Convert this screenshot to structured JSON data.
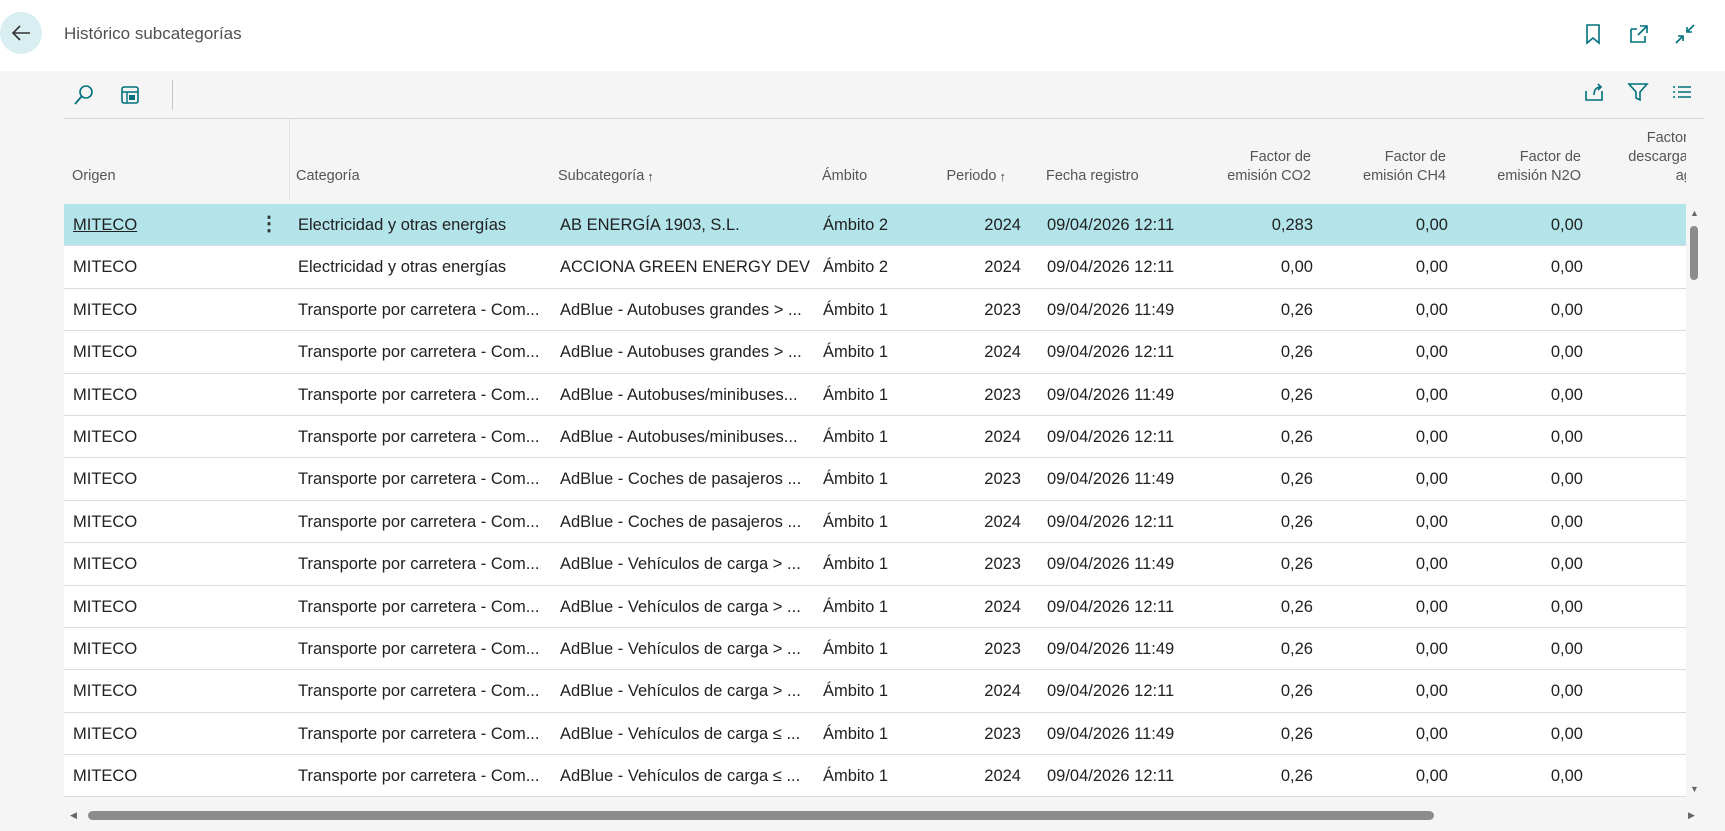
{
  "page": {
    "title": "Histórico subcategorías"
  },
  "icons": {
    "back": "arrow-left-icon",
    "bookmark": "bookmark-icon",
    "open_new": "open-in-new-window-icon",
    "collapse": "collapse-icon",
    "search": "search-icon",
    "layout": "layout-icon",
    "share": "share-icon",
    "filter": "filter-icon",
    "list": "list-view-icon"
  },
  "colors": {
    "accent": "#00717c",
    "selected_row": "#b2e4ea",
    "back_bg": "#d8eef0"
  },
  "columns": {
    "origen": "Origen",
    "categoria": "Categoría",
    "subcategoria": "Subcategoría",
    "ambito": "Ámbito",
    "periodo": "Periodo",
    "fecha": "Fecha registro",
    "co2": "Factor de emisión CO2",
    "ch4": "Factor de emisión CH4",
    "n2o": "Factor de emisión N2O",
    "descarga": "Factor de descarga en agua",
    "sort_arrow": "↑"
  },
  "rows": [
    {
      "origen": "MITECO",
      "categoria": "Electricidad y otras energías",
      "subcategoria": "AB ENERGÍA 1903, S.L.",
      "ambito": "Ámbito 2",
      "periodo": "2024",
      "fecha": "09/04/2026 12:11",
      "co2": "0,283",
      "ch4": "0,00",
      "n2o": "0,00"
    },
    {
      "origen": "MITECO",
      "categoria": "Electricidad y otras energías",
      "subcategoria": "ACCIONA GREEN ENERGY DEV...",
      "ambito": "Ámbito 2",
      "periodo": "2024",
      "fecha": "09/04/2026 12:11",
      "co2": "0,00",
      "ch4": "0,00",
      "n2o": "0,00"
    },
    {
      "origen": "MITECO",
      "categoria": "Transporte por carretera - Com...",
      "subcategoria": "AdBlue - Autobuses grandes > ...",
      "ambito": "Ámbito 1",
      "periodo": "2023",
      "fecha": "09/04/2026 11:49",
      "co2": "0,26",
      "ch4": "0,00",
      "n2o": "0,00"
    },
    {
      "origen": "MITECO",
      "categoria": "Transporte por carretera - Com...",
      "subcategoria": "AdBlue - Autobuses grandes > ...",
      "ambito": "Ámbito 1",
      "periodo": "2024",
      "fecha": "09/04/2026 12:11",
      "co2": "0,26",
      "ch4": "0,00",
      "n2o": "0,00"
    },
    {
      "origen": "MITECO",
      "categoria": "Transporte por carretera - Com...",
      "subcategoria": "AdBlue - Autobuses/minibuses...",
      "ambito": "Ámbito 1",
      "periodo": "2023",
      "fecha": "09/04/2026 11:49",
      "co2": "0,26",
      "ch4": "0,00",
      "n2o": "0,00"
    },
    {
      "origen": "MITECO",
      "categoria": "Transporte por carretera - Com...",
      "subcategoria": "AdBlue - Autobuses/minibuses...",
      "ambito": "Ámbito 1",
      "periodo": "2024",
      "fecha": "09/04/2026 12:11",
      "co2": "0,26",
      "ch4": "0,00",
      "n2o": "0,00"
    },
    {
      "origen": "MITECO",
      "categoria": "Transporte por carretera - Com...",
      "subcategoria": "AdBlue - Coches de pasajeros ...",
      "ambito": "Ámbito 1",
      "periodo": "2023",
      "fecha": "09/04/2026 11:49",
      "co2": "0,26",
      "ch4": "0,00",
      "n2o": "0,00"
    },
    {
      "origen": "MITECO",
      "categoria": "Transporte por carretera - Com...",
      "subcategoria": "AdBlue - Coches de pasajeros ...",
      "ambito": "Ámbito 1",
      "periodo": "2024",
      "fecha": "09/04/2026 12:11",
      "co2": "0,26",
      "ch4": "0,00",
      "n2o": "0,00"
    },
    {
      "origen": "MITECO",
      "categoria": "Transporte por carretera - Com...",
      "subcategoria": "AdBlue - Vehículos de carga > ...",
      "ambito": "Ámbito 1",
      "periodo": "2023",
      "fecha": "09/04/2026 11:49",
      "co2": "0,26",
      "ch4": "0,00",
      "n2o": "0,00"
    },
    {
      "origen": "MITECO",
      "categoria": "Transporte por carretera - Com...",
      "subcategoria": "AdBlue - Vehículos de carga > ...",
      "ambito": "Ámbito 1",
      "periodo": "2024",
      "fecha": "09/04/2026 12:11",
      "co2": "0,26",
      "ch4": "0,00",
      "n2o": "0,00"
    },
    {
      "origen": "MITECO",
      "categoria": "Transporte por carretera - Com...",
      "subcategoria": "AdBlue - Vehículos de carga > ...",
      "ambito": "Ámbito 1",
      "periodo": "2023",
      "fecha": "09/04/2026 11:49",
      "co2": "0,26",
      "ch4": "0,00",
      "n2o": "0,00"
    },
    {
      "origen": "MITECO",
      "categoria": "Transporte por carretera - Com...",
      "subcategoria": "AdBlue - Vehículos de carga > ...",
      "ambito": "Ámbito 1",
      "periodo": "2024",
      "fecha": "09/04/2026 12:11",
      "co2": "0,26",
      "ch4": "0,00",
      "n2o": "0,00"
    },
    {
      "origen": "MITECO",
      "categoria": "Transporte por carretera - Com...",
      "subcategoria": "AdBlue - Vehículos de carga ≤ ...",
      "ambito": "Ámbito 1",
      "periodo": "2023",
      "fecha": "09/04/2026 11:49",
      "co2": "0,26",
      "ch4": "0,00",
      "n2o": "0,00"
    },
    {
      "origen": "MITECO",
      "categoria": "Transporte por carretera - Com...",
      "subcategoria": "AdBlue - Vehículos de carga ≤ ...",
      "ambito": "Ámbito 1",
      "periodo": "2024",
      "fecha": "09/04/2026 12:11",
      "co2": "0,26",
      "ch4": "0,00",
      "n2o": "0,00"
    }
  ]
}
